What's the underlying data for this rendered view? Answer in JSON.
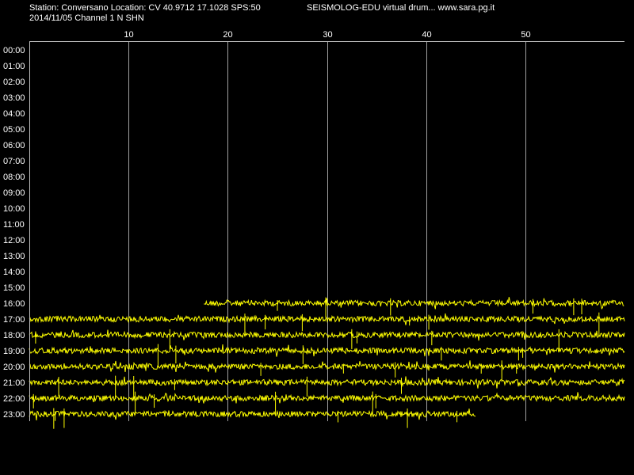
{
  "header": {
    "station": "Station: Conversano Location: CV 40.9712 17.1028 SPS:50",
    "program": "SEISMOLOG-EDU virtual drum... www.sara.pg.it",
    "date_channel": "2014/11/05  Channel 1 N SHN"
  },
  "colors": {
    "background": "#000000",
    "trace": "#ffff00",
    "text": "#ffffff",
    "grid": "#a0a0a0",
    "frame": "#c0c0c0"
  },
  "chart_data": {
    "type": "line",
    "title": "",
    "xlabel": "",
    "ylabel": "",
    "xlim": [
      0,
      60
    ],
    "x_ticks": [
      10,
      20,
      30,
      40,
      50
    ],
    "x_tick_labels": [
      "10",
      "20",
      "30",
      "40",
      "50"
    ],
    "grid": true,
    "grid_orientation": "vertical",
    "hour_labels": [
      "00:00",
      "01:00",
      "02:00",
      "03:00",
      "04:00",
      "05:00",
      "06:00",
      "07:00",
      "08:00",
      "09:00",
      "10:00",
      "11:00",
      "12:00",
      "13:00",
      "14:00",
      "15:00",
      "16:00",
      "17:00",
      "18:00",
      "19:00",
      "20:00",
      "21:00",
      "22:00",
      "23:00"
    ],
    "traces": [
      {
        "hour": "16:00",
        "start_min": 17.6,
        "end_min": 60
      },
      {
        "hour": "17:00",
        "start_min": 0,
        "end_min": 60
      },
      {
        "hour": "18:00",
        "start_min": 0,
        "end_min": 60
      },
      {
        "hour": "19:00",
        "start_min": 0,
        "end_min": 60
      },
      {
        "hour": "20:00",
        "start_min": 0,
        "end_min": 60
      },
      {
        "hour": "21:00",
        "start_min": 0,
        "end_min": 60
      },
      {
        "hour": "22:00",
        "start_min": 0,
        "end_min": 60
      },
      {
        "hour": "23:00",
        "start_min": 0,
        "end_min": 45
      }
    ]
  }
}
